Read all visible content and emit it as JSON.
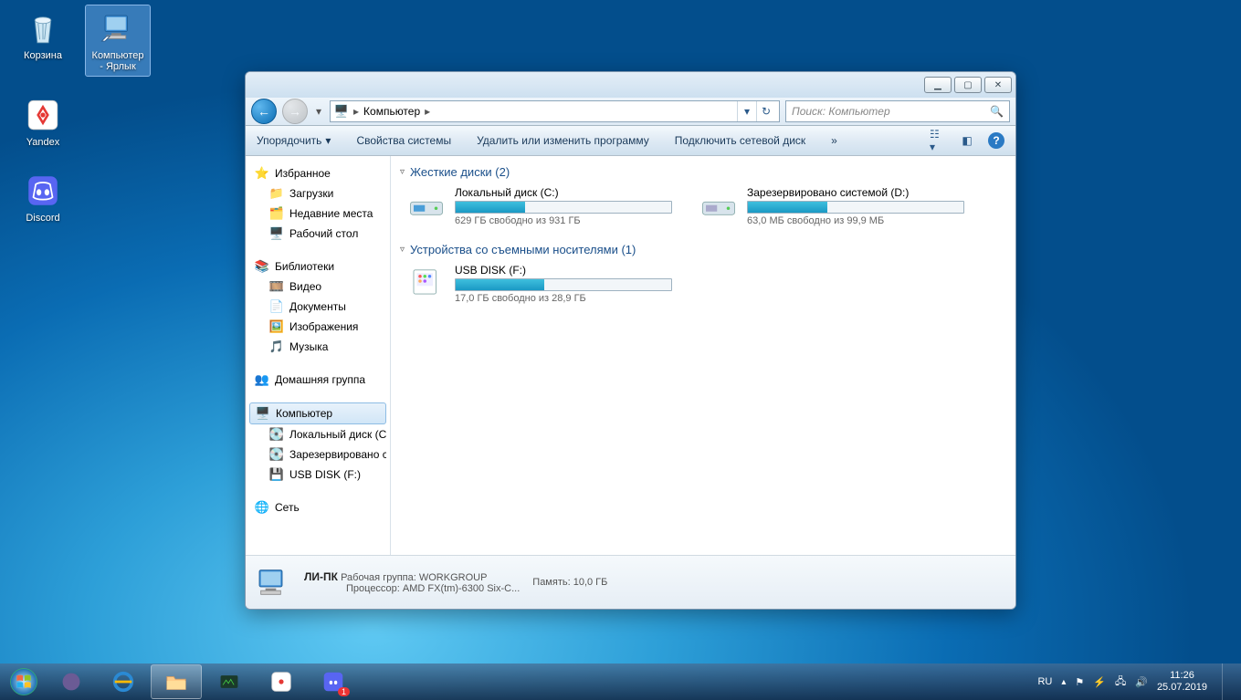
{
  "desktop": {
    "icons": [
      {
        "name": "recycle-bin",
        "label": "Корзина"
      },
      {
        "name": "computer-shortcut",
        "label": "Компьютер - Ярлык",
        "selected": true
      },
      {
        "name": "yandex",
        "label": "Yandex"
      },
      {
        "name": "discord",
        "label": "Discord"
      }
    ]
  },
  "window": {
    "address_location": "Компьютер",
    "search_placeholder": "Поиск: Компьютер",
    "toolbar": {
      "organize": "Упорядочить",
      "properties": "Свойства системы",
      "uninstall": "Удалить или изменить программу",
      "map_drive": "Подключить сетевой диск"
    },
    "sidebar": {
      "favorites": "Избранное",
      "downloads": "Загрузки",
      "recent": "Недавние места",
      "desktop": "Рабочий стол",
      "libraries": "Библиотеки",
      "video": "Видео",
      "documents": "Документы",
      "pictures": "Изображения",
      "music": "Музыка",
      "homegroup": "Домашняя группа",
      "computer": "Компьютер",
      "local_c": "Локальный диск (C:)",
      "reserved_d": "Зарезервировано системой (D:)",
      "usb_f": "USB DISK (F:)",
      "network": "Сеть"
    },
    "groups": {
      "hdd": "Жесткие диски (2)",
      "removable": "Устройства со съемными носителями (1)"
    },
    "drives": {
      "c": {
        "name": "Локальный диск (C:)",
        "text": "629 ГБ свободно из 931 ГБ",
        "fill_pct": 32
      },
      "d": {
        "name": "Зарезервировано системой (D:)",
        "text": "63,0 МБ свободно из 99,9 МБ",
        "fill_pct": 37
      },
      "f": {
        "name": "USB DISK (F:)",
        "text": "17,0 ГБ свободно из 28,9 ГБ",
        "fill_pct": 41
      }
    },
    "details": {
      "pc_name": "ЛИ-ПК",
      "workgroup_label": "Рабочая группа:",
      "workgroup": "WORKGROUP",
      "cpu_label": "Процессор:",
      "cpu": "AMD FX(tm)-6300 Six-C...",
      "mem_label": "Память:",
      "mem": "10,0 ГБ"
    }
  },
  "taskbar": {
    "lang": "RU",
    "time": "11:26",
    "date": "25.07.2019"
  }
}
